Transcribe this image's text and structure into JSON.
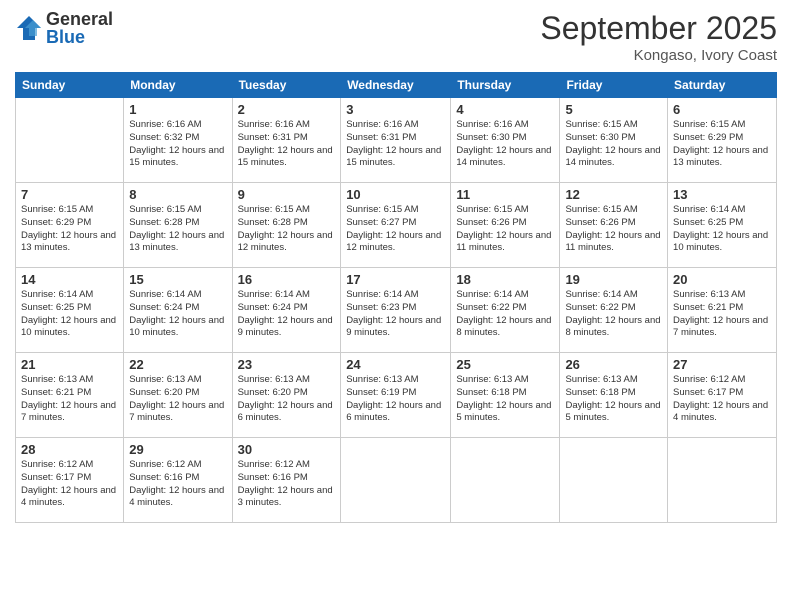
{
  "header": {
    "logo_general": "General",
    "logo_blue": "Blue",
    "month": "September 2025",
    "location": "Kongaso, Ivory Coast"
  },
  "weekdays": [
    "Sunday",
    "Monday",
    "Tuesday",
    "Wednesday",
    "Thursday",
    "Friday",
    "Saturday"
  ],
  "weeks": [
    [
      {
        "day": "",
        "sunrise": "",
        "sunset": "",
        "daylight": ""
      },
      {
        "day": "1",
        "sunrise": "Sunrise: 6:16 AM",
        "sunset": "Sunset: 6:32 PM",
        "daylight": "Daylight: 12 hours and 15 minutes."
      },
      {
        "day": "2",
        "sunrise": "Sunrise: 6:16 AM",
        "sunset": "Sunset: 6:31 PM",
        "daylight": "Daylight: 12 hours and 15 minutes."
      },
      {
        "day": "3",
        "sunrise": "Sunrise: 6:16 AM",
        "sunset": "Sunset: 6:31 PM",
        "daylight": "Daylight: 12 hours and 15 minutes."
      },
      {
        "day": "4",
        "sunrise": "Sunrise: 6:16 AM",
        "sunset": "Sunset: 6:30 PM",
        "daylight": "Daylight: 12 hours and 14 minutes."
      },
      {
        "day": "5",
        "sunrise": "Sunrise: 6:15 AM",
        "sunset": "Sunset: 6:30 PM",
        "daylight": "Daylight: 12 hours and 14 minutes."
      },
      {
        "day": "6",
        "sunrise": "Sunrise: 6:15 AM",
        "sunset": "Sunset: 6:29 PM",
        "daylight": "Daylight: 12 hours and 13 minutes."
      }
    ],
    [
      {
        "day": "7",
        "sunrise": "Sunrise: 6:15 AM",
        "sunset": "Sunset: 6:29 PM",
        "daylight": "Daylight: 12 hours and 13 minutes."
      },
      {
        "day": "8",
        "sunrise": "Sunrise: 6:15 AM",
        "sunset": "Sunset: 6:28 PM",
        "daylight": "Daylight: 12 hours and 13 minutes."
      },
      {
        "day": "9",
        "sunrise": "Sunrise: 6:15 AM",
        "sunset": "Sunset: 6:28 PM",
        "daylight": "Daylight: 12 hours and 12 minutes."
      },
      {
        "day": "10",
        "sunrise": "Sunrise: 6:15 AM",
        "sunset": "Sunset: 6:27 PM",
        "daylight": "Daylight: 12 hours and 12 minutes."
      },
      {
        "day": "11",
        "sunrise": "Sunrise: 6:15 AM",
        "sunset": "Sunset: 6:26 PM",
        "daylight": "Daylight: 12 hours and 11 minutes."
      },
      {
        "day": "12",
        "sunrise": "Sunrise: 6:15 AM",
        "sunset": "Sunset: 6:26 PM",
        "daylight": "Daylight: 12 hours and 11 minutes."
      },
      {
        "day": "13",
        "sunrise": "Sunrise: 6:14 AM",
        "sunset": "Sunset: 6:25 PM",
        "daylight": "Daylight: 12 hours and 10 minutes."
      }
    ],
    [
      {
        "day": "14",
        "sunrise": "Sunrise: 6:14 AM",
        "sunset": "Sunset: 6:25 PM",
        "daylight": "Daylight: 12 hours and 10 minutes."
      },
      {
        "day": "15",
        "sunrise": "Sunrise: 6:14 AM",
        "sunset": "Sunset: 6:24 PM",
        "daylight": "Daylight: 12 hours and 10 minutes."
      },
      {
        "day": "16",
        "sunrise": "Sunrise: 6:14 AM",
        "sunset": "Sunset: 6:24 PM",
        "daylight": "Daylight: 12 hours and 9 minutes."
      },
      {
        "day": "17",
        "sunrise": "Sunrise: 6:14 AM",
        "sunset": "Sunset: 6:23 PM",
        "daylight": "Daylight: 12 hours and 9 minutes."
      },
      {
        "day": "18",
        "sunrise": "Sunrise: 6:14 AM",
        "sunset": "Sunset: 6:22 PM",
        "daylight": "Daylight: 12 hours and 8 minutes."
      },
      {
        "day": "19",
        "sunrise": "Sunrise: 6:14 AM",
        "sunset": "Sunset: 6:22 PM",
        "daylight": "Daylight: 12 hours and 8 minutes."
      },
      {
        "day": "20",
        "sunrise": "Sunrise: 6:13 AM",
        "sunset": "Sunset: 6:21 PM",
        "daylight": "Daylight: 12 hours and 7 minutes."
      }
    ],
    [
      {
        "day": "21",
        "sunrise": "Sunrise: 6:13 AM",
        "sunset": "Sunset: 6:21 PM",
        "daylight": "Daylight: 12 hours and 7 minutes."
      },
      {
        "day": "22",
        "sunrise": "Sunrise: 6:13 AM",
        "sunset": "Sunset: 6:20 PM",
        "daylight": "Daylight: 12 hours and 7 minutes."
      },
      {
        "day": "23",
        "sunrise": "Sunrise: 6:13 AM",
        "sunset": "Sunset: 6:20 PM",
        "daylight": "Daylight: 12 hours and 6 minutes."
      },
      {
        "day": "24",
        "sunrise": "Sunrise: 6:13 AM",
        "sunset": "Sunset: 6:19 PM",
        "daylight": "Daylight: 12 hours and 6 minutes."
      },
      {
        "day": "25",
        "sunrise": "Sunrise: 6:13 AM",
        "sunset": "Sunset: 6:18 PM",
        "daylight": "Daylight: 12 hours and 5 minutes."
      },
      {
        "day": "26",
        "sunrise": "Sunrise: 6:13 AM",
        "sunset": "Sunset: 6:18 PM",
        "daylight": "Daylight: 12 hours and 5 minutes."
      },
      {
        "day": "27",
        "sunrise": "Sunrise: 6:12 AM",
        "sunset": "Sunset: 6:17 PM",
        "daylight": "Daylight: 12 hours and 4 minutes."
      }
    ],
    [
      {
        "day": "28",
        "sunrise": "Sunrise: 6:12 AM",
        "sunset": "Sunset: 6:17 PM",
        "daylight": "Daylight: 12 hours and 4 minutes."
      },
      {
        "day": "29",
        "sunrise": "Sunrise: 6:12 AM",
        "sunset": "Sunset: 6:16 PM",
        "daylight": "Daylight: 12 hours and 4 minutes."
      },
      {
        "day": "30",
        "sunrise": "Sunrise: 6:12 AM",
        "sunset": "Sunset: 6:16 PM",
        "daylight": "Daylight: 12 hours and 3 minutes."
      },
      {
        "day": "",
        "sunrise": "",
        "sunset": "",
        "daylight": ""
      },
      {
        "day": "",
        "sunrise": "",
        "sunset": "",
        "daylight": ""
      },
      {
        "day": "",
        "sunrise": "",
        "sunset": "",
        "daylight": ""
      },
      {
        "day": "",
        "sunrise": "",
        "sunset": "",
        "daylight": ""
      }
    ]
  ]
}
